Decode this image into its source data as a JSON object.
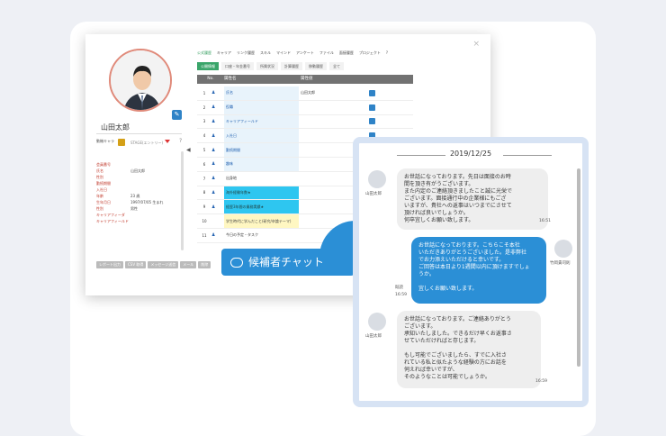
{
  "crm": {
    "name": "山田太郎",
    "stage_label": "動機キャラ",
    "stage_value": "STAGE(エントリー)",
    "fields": [
      {
        "label": "会員番号",
        "value": ""
      },
      {
        "label": "氏名",
        "value": "山田太郎"
      },
      {
        "label": "性別",
        "value": ""
      },
      {
        "label": "勤続期間",
        "value": ""
      },
      {
        "label": "入社日",
        "value": ""
      },
      {
        "label": "年齢",
        "value": "23 歳"
      },
      {
        "label": "生年月日",
        "value": "1997/07/05 生まれ"
      },
      {
        "label": "性別",
        "value": "男性"
      },
      {
        "label": "キャリアフィーダ",
        "value": ""
      },
      {
        "label": "キャリアフィールド",
        "value": ""
      }
    ],
    "buttons": [
      "レポート出力",
      "CSV 取得",
      "メッセージ送信",
      "メール",
      "削除"
    ],
    "tabs": [
      "公式履歴",
      "キャリア",
      "リンク履歴",
      "スキル",
      "マインド",
      "アンケート",
      "ファイル",
      "面接履歴",
      "プロジェクト",
      "?"
    ],
    "subtabs": [
      "公開情報",
      "口座・年金番号",
      "所属状況",
      "計算履歴",
      "移動履歴",
      "全て"
    ],
    "table_headers": [
      "No.",
      "属性名",
      "属性値"
    ],
    "rows": [
      {
        "no": "1",
        "name": "氏名",
        "value": "山田太郎",
        "style": "blue"
      },
      {
        "no": "2",
        "name": "役職",
        "value": "",
        "style": "blue"
      },
      {
        "no": "3",
        "name": "キャリアフィールド",
        "value": "",
        "style": "blue"
      },
      {
        "no": "4",
        "name": "入社日",
        "value": "",
        "style": "blue"
      },
      {
        "no": "5",
        "name": "勤続期間",
        "value": "",
        "style": "blue"
      },
      {
        "no": "6",
        "name": "趣味",
        "value": "",
        "style": "blue"
      },
      {
        "no": "7",
        "name": "出身地",
        "value": "",
        "style": "plain"
      },
      {
        "no": "8",
        "name": "海外経験年数★",
        "value": "",
        "style": "cyan"
      },
      {
        "no": "9",
        "name": "経歴3年間の業務実績★",
        "value": "",
        "style": "cyan"
      },
      {
        "no": "10",
        "name": "学生時代に学んだこと(研究/卒論テーマ)",
        "value": "",
        "style": "yellow"
      },
      {
        "no": "11",
        "name": "今日の予定・タスク",
        "value": "",
        "style": "plain"
      }
    ]
  },
  "chat_button": "候補者チャット",
  "chat": {
    "date": "2019/12/25",
    "messages": [
      {
        "dir": "in",
        "author": "山田太郎",
        "text": "お世話になっております。先日は面接のお時\n間を頂き有がうございます。\nまた内定のご連絡頂きましたこと誠に光栄で\nございます。面接通行中の企業様にもござ\nいますが、貴社への返事はいつまでにさせて\n頂ければ良いでしょうか。\n何卒宜しくお願い致します。",
        "time": "16:51"
      },
      {
        "dir": "out",
        "author": "竹岡貴司則",
        "text": "お世話になっております。こちらこそ本社\nいただきありがとうございました。是非弊社\nでお力添えいただけると幸いです。\nご回答は本日より1週間以内に頂けますでしょ\nうか。\n\n宜しくお願い致します。",
        "time": "16:59",
        "status": "既読"
      },
      {
        "dir": "in",
        "author": "山田太郎",
        "text": "お世話になっております。ご連絡ありがとう\nございます。\n承知いたしました。できるだけ早くお返事さ\nせていただければと存じます。\n\nもし可能でございましたら、すでに入社さ\nれている私と似たような経験の方にお話を\n伺えれば幸いですが、\nそのようなことは可能でしょうか。",
        "time": "16:59"
      }
    ]
  }
}
